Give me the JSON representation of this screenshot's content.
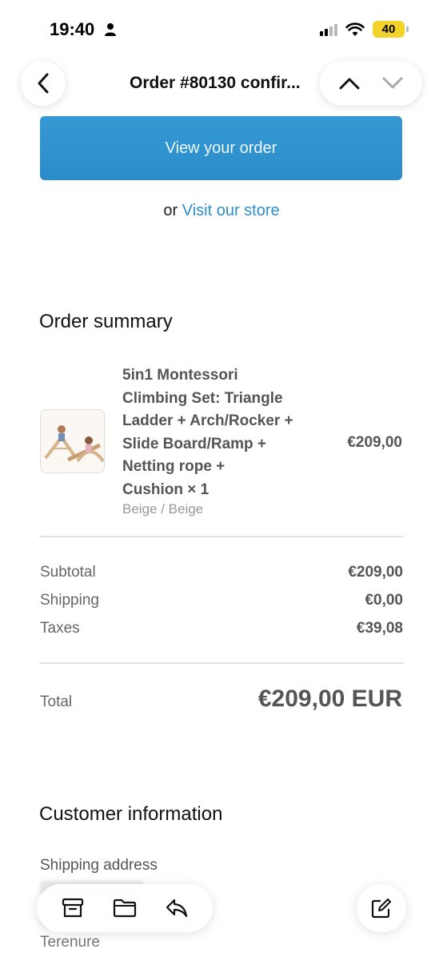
{
  "status_bar": {
    "time": "19:40",
    "battery": "40"
  },
  "nav": {
    "title": "Order #80130 confir..."
  },
  "content": {
    "view_order_label": "View your order",
    "or_text": "or",
    "visit_store_label": "Visit our store"
  },
  "order_summary": {
    "title": "Order summary",
    "product": {
      "name_lines": [
        "5in1 Montessori",
        "Climbing Set: Triangle",
        "Ladder + Arch/Rocker +",
        "Slide Board/Ramp +",
        "Netting rope +",
        "Cushion × 1"
      ],
      "variant": "Beige / Beige",
      "price": "€209,00"
    },
    "subtotal_label": "Subtotal",
    "subtotal_value": "€209,00",
    "shipping_label": "Shipping",
    "shipping_value": "€0,00",
    "taxes_label": "Taxes",
    "taxes_value": "€39,08",
    "total_label": "Total",
    "total_value": "€209,00 EUR"
  },
  "customer": {
    "title": "Customer information",
    "shipping_address_label": "Shipping address",
    "address_line_visible": "Terenure"
  },
  "colors": {
    "accent": "#2f95d1",
    "link": "#2c8fc9",
    "battery": "#f2d32a"
  },
  "icons": [
    "person-icon",
    "signal-icon",
    "wifi-icon",
    "battery-icon",
    "back-chevron-icon",
    "chevron-up-icon",
    "chevron-down-icon",
    "archive-icon",
    "folder-icon",
    "reply-icon",
    "compose-icon"
  ]
}
